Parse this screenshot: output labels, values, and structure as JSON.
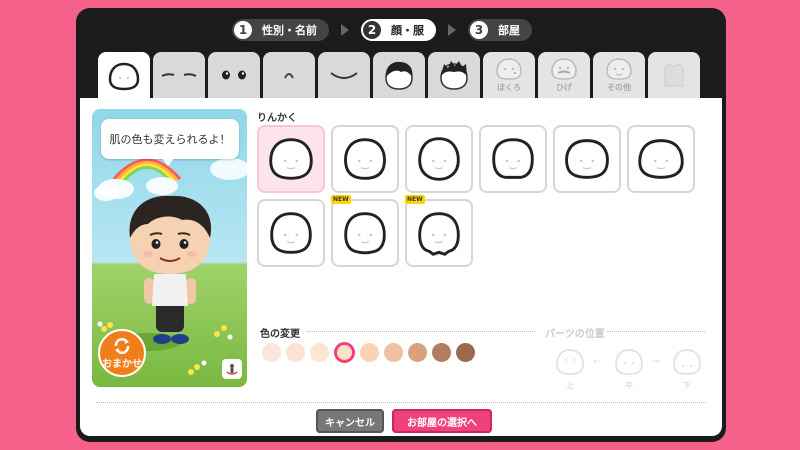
{
  "steps": [
    {
      "num": "1",
      "label": "性別・名前"
    },
    {
      "num": "2",
      "label": "顔・服"
    },
    {
      "num": "3",
      "label": "部屋"
    }
  ],
  "tabs": [
    {
      "name": "tab-face-shape",
      "icon": "face-icon",
      "label": ""
    },
    {
      "name": "tab-eyebrows",
      "icon": "eyebrows-icon",
      "label": ""
    },
    {
      "name": "tab-eyes",
      "icon": "eyes-icon",
      "label": ""
    },
    {
      "name": "tab-nose",
      "icon": "nose-icon",
      "label": ""
    },
    {
      "name": "tab-mouth",
      "icon": "mouth-icon",
      "label": ""
    },
    {
      "name": "tab-hair-1",
      "icon": "hair-icon",
      "label": ""
    },
    {
      "name": "tab-hair-2",
      "icon": "hair-icon",
      "label": ""
    },
    {
      "name": "tab-mole",
      "icon": "mole-icon",
      "label": "ほくろ"
    },
    {
      "name": "tab-beard",
      "icon": "beard-icon",
      "label": "ひげ"
    },
    {
      "name": "tab-other",
      "icon": "other-icon",
      "label": "その他"
    },
    {
      "name": "tab-clothes",
      "icon": "shirt-icon",
      "label": ""
    }
  ],
  "preview": {
    "bubble_text": "肌の色も変えられるよ！",
    "omakase_label": "おまかせ"
  },
  "parts": {
    "title": "りんかく",
    "new_label": "NEW",
    "items": [
      {
        "name": "face-shape-1",
        "selected": true,
        "is_new": false
      },
      {
        "name": "face-shape-2",
        "selected": false,
        "is_new": false
      },
      {
        "name": "face-shape-3",
        "selected": false,
        "is_new": false
      },
      {
        "name": "face-shape-4",
        "selected": false,
        "is_new": false
      },
      {
        "name": "face-shape-5",
        "selected": false,
        "is_new": false
      },
      {
        "name": "face-shape-6",
        "selected": false,
        "is_new": false
      },
      {
        "name": "face-shape-7",
        "selected": false,
        "is_new": false
      },
      {
        "name": "face-shape-8",
        "selected": false,
        "is_new": true
      },
      {
        "name": "face-shape-9",
        "selected": false,
        "is_new": true
      }
    ]
  },
  "color_change": {
    "title": "色の変更",
    "swatches": [
      "#fbe5de",
      "#fde2d5",
      "#fde6cf",
      "#fde2c6",
      "#fad3b5",
      "#eec2a0",
      "#d9a27e",
      "#b07d5e",
      "#9a6a4a"
    ],
    "selected_index": 3
  },
  "parts_position": {
    "title": "パーツの位置",
    "up": "上",
    "middle": "中",
    "down": "下"
  },
  "buttons": {
    "cancel": "キャンセル",
    "next": "お部屋の選択へ"
  }
}
